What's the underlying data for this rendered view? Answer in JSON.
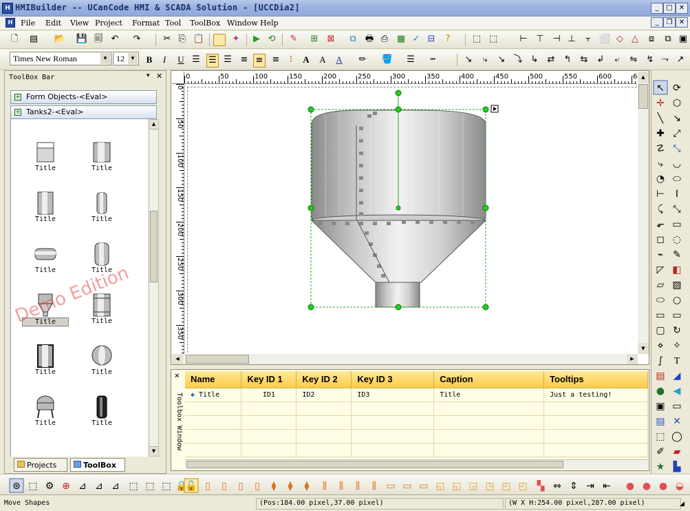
{
  "window": {
    "title": "HMIBuilder -- UCanCode HMI & SCADA Solution - [UCCDia2]"
  },
  "menu": [
    "File",
    "Edit",
    "View",
    "Project",
    "Format",
    "Tool",
    "ToolBox",
    "Window",
    "Help"
  ],
  "format": {
    "font": "Times New Roman",
    "size": "12"
  },
  "toolbox_panel": {
    "title": "ToolBox Bar",
    "groups": [
      "Form Objects-<Eval>",
      "Tanks2-<Eval>"
    ],
    "item_label": "Title",
    "watermark": "Demo Edition",
    "tabs": [
      "Projects",
      "ToolBox"
    ]
  },
  "ruler": {
    "h_ticks": [
      "0",
      "50",
      "100",
      "150",
      "200",
      "250",
      "300",
      "350",
      "400",
      "450",
      "500",
      "550",
      "600",
      "6"
    ],
    "v_ticks": [
      "0",
      "50",
      "100",
      "150",
      "200",
      "250",
      "300",
      "350"
    ]
  },
  "grid": {
    "side_title": "Toolbox Window",
    "columns": [
      "Name",
      "Key ID 1",
      "Key ID 2",
      "Key ID 3",
      "Caption",
      "Tooltips"
    ],
    "rows": [
      [
        "Title",
        "ID1",
        "ID2",
        "ID3",
        "Title",
        "Just a testing!"
      ]
    ]
  },
  "status": {
    "mode": "Move Shapes",
    "pos": "(Pos:184.00 pixel,37.00 pixel)",
    "size": "(W X H:254.00 pixel,287.00 pixel)"
  },
  "colors": {
    "accent": "#316ac5",
    "grid_header": "#ffd35a",
    "selection_handle": "#22cc22",
    "watermark": "#e65050"
  }
}
